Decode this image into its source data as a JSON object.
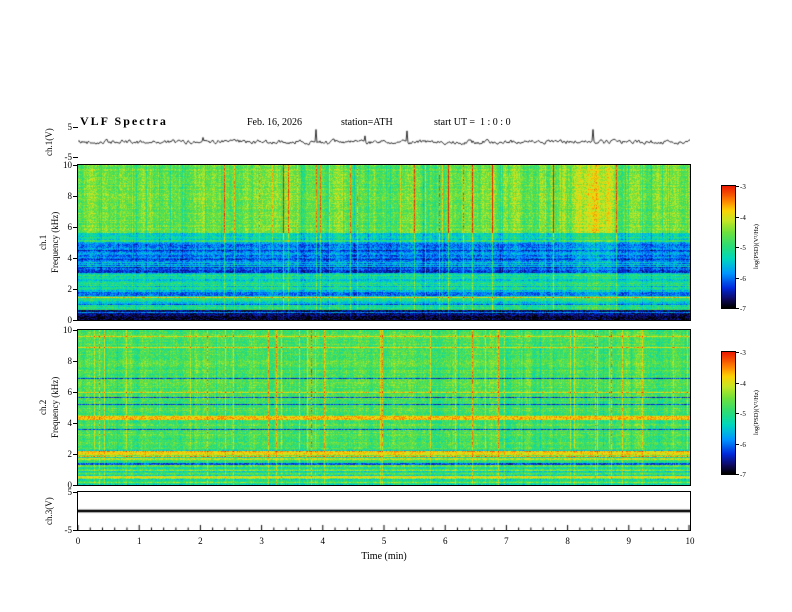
{
  "header": {
    "title": "VLF Spectra",
    "date": "Feb. 16, 2026",
    "station": "station=ATH",
    "start_ut": "start UT =  1 : 0 : 0"
  },
  "axes": {
    "time_label": "Time (min)",
    "time_ticks": [
      0,
      1,
      2,
      3,
      4,
      5,
      6,
      7,
      8,
      9,
      10
    ],
    "wave1_label": "ch.1(V)",
    "wave1_ticks": [
      5,
      -5
    ],
    "spec1_label_ch": "ch.1",
    "spec2_label_ch": "ch.2",
    "spec_freq_label": "Frequency (kHz)",
    "spec_ticks": [
      10,
      8,
      6,
      4,
      2,
      0
    ],
    "wave3_label": "ch.3(V)",
    "wave3_ticks": [
      5,
      -5
    ]
  },
  "colorbar": {
    "label": "log(PSD)(V²/Hz)",
    "ticks": [
      -3,
      -4,
      -5,
      -6,
      -7
    ],
    "range": [
      -7,
      -3
    ]
  },
  "chart_data": [
    {
      "type": "line",
      "name": "ch1_waveform",
      "ylabel": "ch.1(V)",
      "ylim": [
        -5,
        5
      ],
      "yticks": [
        5,
        -5
      ],
      "xlim": [
        0,
        10
      ],
      "description": "Continuous noisy VLF time series oscillating about 0 V (~±1 V) with roughly 25 impulsive sferic spikes reaching about ±4 V spread over the 10 minutes"
    },
    {
      "type": "heatmap",
      "name": "ch1_spectrogram",
      "ylabel": "ch.1 Frequency (kHz)",
      "ylim": [
        0,
        10
      ],
      "yticks": [
        0,
        2,
        4,
        6,
        8,
        10
      ],
      "xlim": [
        0,
        10
      ],
      "zlabel": "log(PSD)(V²/Hz)",
      "zlim": [
        -7,
        -3
      ],
      "features": [
        {
          "band_khz": [
            5.5,
            10
          ],
          "approx_level": -4.3,
          "desc": "green background with dense vertical yellow/orange/red sferic streaks; strongest red patch near 8.3 min at 8-10 kHz"
        },
        {
          "band_khz": [
            3,
            5.5
          ],
          "approx_level": -6.2,
          "desc": "dark blue horizontally banded region with dashed blue/black rows"
        },
        {
          "band_khz": [
            0.5,
            3
          ],
          "approx_level": -5.2,
          "desc": "alternating green/cyan/blue horizontal stripes with occasional thin orange lines"
        },
        {
          "band_khz": [
            0,
            0.5
          ],
          "approx_level": -7.0,
          "desc": "near-black rows (filtered/notch band) with a solid black line at ~0.5 kHz"
        }
      ]
    },
    {
      "type": "heatmap",
      "name": "ch2_spectrogram",
      "ylabel": "ch.2 Frequency (kHz)",
      "ylim": [
        0,
        10
      ],
      "yticks": [
        0,
        2,
        4,
        6,
        8,
        10
      ],
      "xlim": [
        0,
        10
      ],
      "zlabel": "log(PSD)(V²/Hz)",
      "zlim": [
        -7,
        -3
      ],
      "features": [
        {
          "band_khz": [
            2.5,
            10
          ],
          "approx_level": -4.6,
          "desc": "fairly uniform green with vertical yellow sferic streaks and thin scattered dark rows"
        },
        {
          "line_khz": 4.3,
          "approx_level": -3.5,
          "desc": "bright orange horizontal interference line"
        },
        {
          "line_khz": 2.0,
          "approx_level": -3.7,
          "desc": "orange-yellow horizontal line"
        },
        {
          "line_khz": 1.65,
          "approx_level": -4.0,
          "desc": "yellow horizontal line"
        },
        {
          "band_khz": [
            0,
            2.5
          ],
          "approx_level": -4.8,
          "desc": "striped green/yellow/cyan horizontal bands"
        }
      ]
    },
    {
      "type": "line",
      "name": "ch3_waveform",
      "ylabel": "ch.3(V)",
      "ylim": [
        -5,
        5
      ],
      "yticks": [
        5,
        -5
      ],
      "xlim": [
        0,
        10
      ],
      "constant_value": 0,
      "description": "Flat thick black line at 0 V for the whole record (channel flat/off)"
    }
  ]
}
